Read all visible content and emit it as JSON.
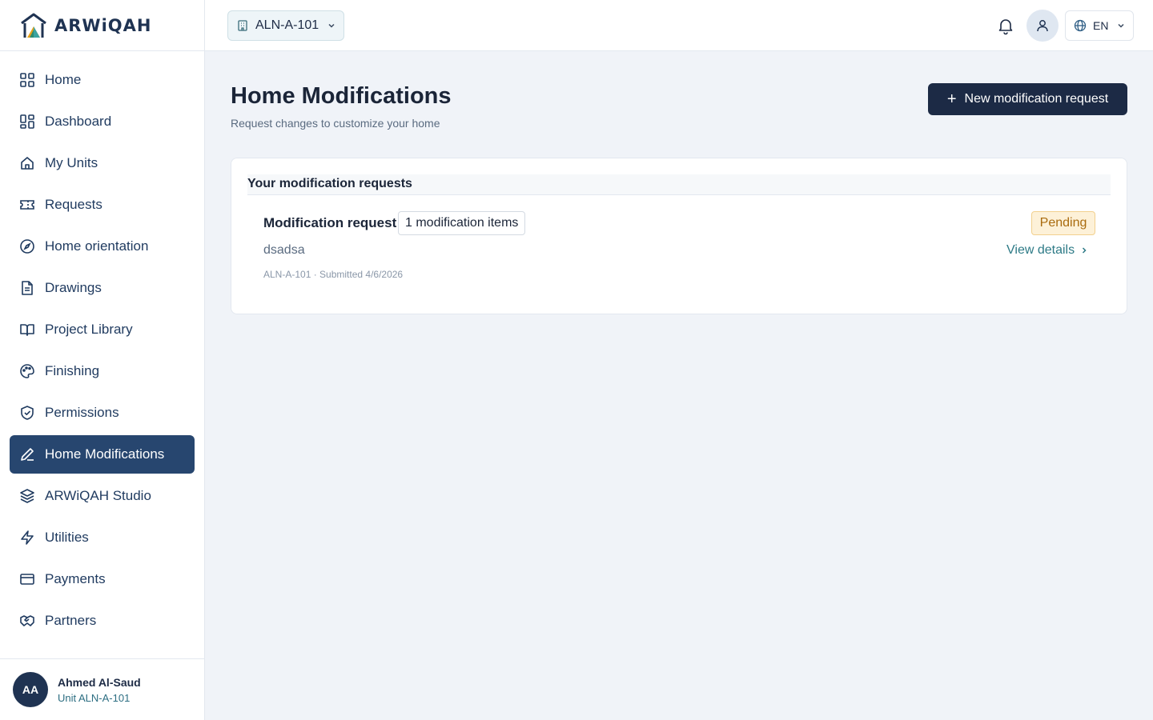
{
  "brand": {
    "name": "ARWiQAH"
  },
  "sidebar": {
    "items": [
      {
        "label": "Home",
        "icon": "grid-icon"
      },
      {
        "label": "Dashboard",
        "icon": "dashboard-icon"
      },
      {
        "label": "My Units",
        "icon": "house-icon"
      },
      {
        "label": "Requests",
        "icon": "ticket-icon"
      },
      {
        "label": "Home orientation",
        "icon": "compass-icon"
      },
      {
        "label": "Drawings",
        "icon": "document-icon"
      },
      {
        "label": "Project Library",
        "icon": "book-icon"
      },
      {
        "label": "Finishing",
        "icon": "palette-icon"
      },
      {
        "label": "Permissions",
        "icon": "shield-check-icon"
      },
      {
        "label": "Home Modifications",
        "icon": "pencil-icon",
        "active": true
      },
      {
        "label": "ARWiQAH Studio",
        "icon": "layers-icon"
      },
      {
        "label": "Utilities",
        "icon": "lightning-icon"
      },
      {
        "label": "Payments",
        "icon": "credit-card-icon"
      },
      {
        "label": "Partners",
        "icon": "handshake-icon"
      }
    ],
    "user": {
      "initials": "AA",
      "name": "Ahmed Al-Saud",
      "unit": "Unit ALN-A-101"
    }
  },
  "topbar": {
    "unit_selector": "ALN-A-101",
    "language": "EN"
  },
  "main": {
    "title": "Home Modifications",
    "subtitle": "Request changes to customize your home",
    "new_button": "New modification request",
    "card": {
      "heading": "Your modification requests",
      "request": {
        "title": "Modification request",
        "items_badge": "1 modification items",
        "status": "Pending",
        "description": "dsadsa",
        "view_link": "View details",
        "meta": "ALN-A-101 · Submitted 4/6/2026"
      }
    }
  },
  "colors": {
    "sidebar_active": "#27466f",
    "primary_button": "#1c2a45",
    "pending_bg": "#fdf1d8",
    "pending_text": "#a96b0e",
    "link": "#2d7a86"
  }
}
